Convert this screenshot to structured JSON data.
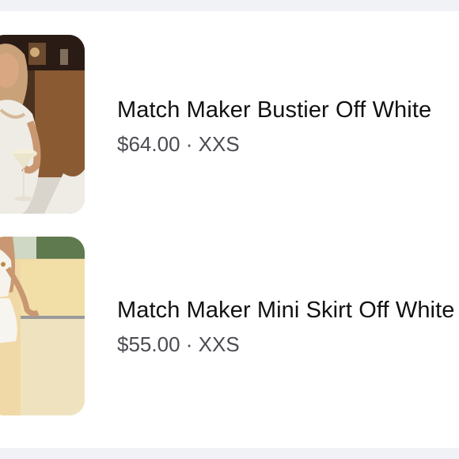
{
  "items": [
    {
      "title": "Match Maker Bustier Off White",
      "price": "$64.00",
      "separator": "·",
      "size": "XXS",
      "image": "product-photo-bustier"
    },
    {
      "title": "Match Maker Mini Skirt Off White",
      "price": "$55.00",
      "separator": "·",
      "size": "XXS",
      "image": "product-photo-mini-skirt"
    }
  ],
  "colors": {
    "background": "#f1f2f6",
    "card": "#ffffff",
    "title": "#111111",
    "meta": "#4b4b52"
  }
}
